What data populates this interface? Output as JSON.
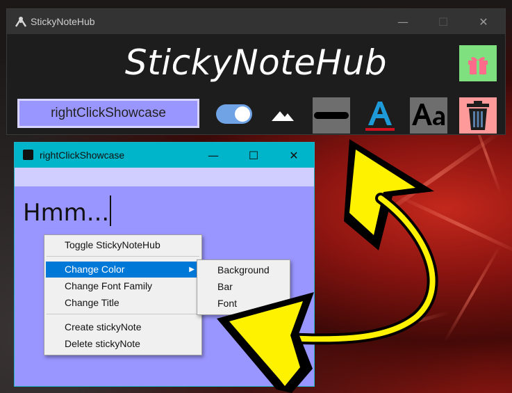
{
  "hub": {
    "window_title": "StickyNoteHub",
    "heading": "StickyNoteHub",
    "note_title": "rightClickShowcase",
    "controls": {
      "minimize": "—",
      "maximize": "☐",
      "close": "✕"
    },
    "icons": [
      "gift-icon",
      "toggle-switch",
      "mountains-icon",
      "bar-line-icon",
      "font-color-icon",
      "font-family-icon",
      "trash-icon"
    ]
  },
  "note": {
    "window_title": "rightClickShowcase",
    "text": "Hmm...",
    "controls": {
      "minimize": "—",
      "maximize": "☐",
      "close": "✕"
    }
  },
  "context_menu": {
    "items": [
      "Toggle StickyNoteHub",
      "Change Color",
      "Change Font Family",
      "Change Title",
      "Create stickyNote",
      "Delete stickyNote"
    ],
    "highlighted": "Change Color",
    "submenu_arrow": "▶"
  },
  "submenu": {
    "items": [
      "Background",
      "Bar",
      "Font"
    ]
  },
  "colors": {
    "hub_bg": "#1d1d1d",
    "hub_titlebar": "#333333",
    "note_bg": "#9a96ff",
    "note_titlebar": "#00b5c9",
    "note_bar": "#d0ceff",
    "menu_highlight": "#0078d7",
    "annotation_arrow": "#ffee00"
  }
}
